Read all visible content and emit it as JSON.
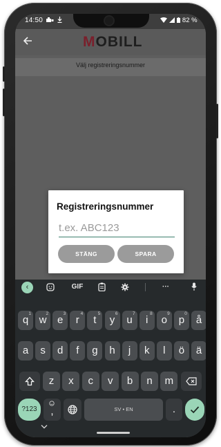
{
  "status_bar": {
    "time": "14:50",
    "battery": "82 %"
  },
  "app": {
    "logo_first_letter": "M",
    "logo_rest": "OBILL",
    "subtitle": "Välj registreringsnummer"
  },
  "dialog": {
    "title": "Registreringsnummer",
    "input_placeholder": "t.ex. ABC123",
    "input_value": "",
    "close_label": "STÄNG",
    "save_label": "SPARA"
  },
  "keyboard": {
    "toolbar": {
      "gif_label": "GIF",
      "more_label": "···"
    },
    "rows": [
      [
        {
          "k": "q",
          "h": "1"
        },
        {
          "k": "w",
          "h": "2"
        },
        {
          "k": "e",
          "h": "3"
        },
        {
          "k": "r",
          "h": "4"
        },
        {
          "k": "t",
          "h": "5"
        },
        {
          "k": "y",
          "h": "6"
        },
        {
          "k": "u",
          "h": "7"
        },
        {
          "k": "i",
          "h": "8"
        },
        {
          "k": "o",
          "h": "9"
        },
        {
          "k": "p",
          "h": "0"
        },
        {
          "k": "å",
          "h": ""
        }
      ],
      [
        {
          "k": "a"
        },
        {
          "k": "s"
        },
        {
          "k": "d"
        },
        {
          "k": "f"
        },
        {
          "k": "g"
        },
        {
          "k": "h"
        },
        {
          "k": "j"
        },
        {
          "k": "k"
        },
        {
          "k": "l"
        },
        {
          "k": "ö"
        },
        {
          "k": "ä"
        }
      ],
      [
        {
          "k": "z"
        },
        {
          "k": "x"
        },
        {
          "k": "c"
        },
        {
          "k": "v"
        },
        {
          "k": "b"
        },
        {
          "k": "n"
        },
        {
          "k": "m"
        }
      ]
    ],
    "symbols_label": "?123",
    "comma_label": ",",
    "period_label": ".",
    "space_label": "SV • EN"
  },
  "icons": {
    "back": "arrow-back-icon",
    "shift": "shift-icon",
    "backspace": "backspace-icon",
    "globe": "globe-icon",
    "enter": "check-icon",
    "mic": "mic-icon",
    "settings": "gear-icon",
    "clipboard": "clipboard-icon",
    "sticker": "sticker-icon",
    "collapse": "chevron-left-icon"
  },
  "colors": {
    "accent": "#9ad5b7",
    "logo_accent": "#7a1f2b",
    "input_underline": "#3c7f6c",
    "button_grey": "#9b9b9b"
  }
}
